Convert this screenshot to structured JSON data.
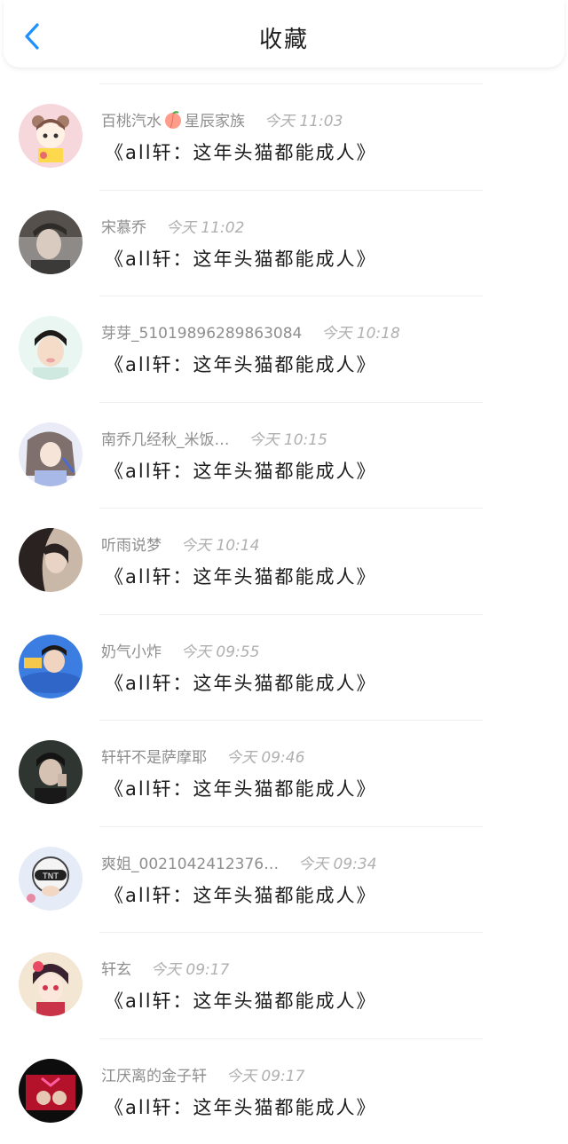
{
  "header": {
    "title": "收藏"
  },
  "items": [
    {
      "name": "百桃汽水",
      "name_suffix": "星辰家族",
      "time": "今天 11:03",
      "message": "《all轩：这年头猫都能成人》"
    },
    {
      "name": "宋慕乔",
      "name_suffix": "",
      "time": "今天 11:02",
      "message": "《all轩：这年头猫都能成人》"
    },
    {
      "name": "芽芽_5101989628986308​4",
      "name_suffix": "",
      "time": "今天 10:18",
      "message": "《all轩：这年头猫都能成人》"
    },
    {
      "name": "南乔几经秋_米饭…",
      "name_suffix": "",
      "time": "今天 10:15",
      "message": "《all轩：这年头猫都能成人》"
    },
    {
      "name": "听雨说梦",
      "name_suffix": "",
      "time": "今天 10:14",
      "message": "《all轩：这年头猫都能成人》"
    },
    {
      "name": "奶气小炸",
      "name_suffix": "",
      "time": "今天 09:55",
      "message": "《all轩：这年头猫都能成人》"
    },
    {
      "name": "轩轩不是萨摩耶",
      "name_suffix": "",
      "time": "今天 09:46",
      "message": "《all轩：这年头猫都能成人》"
    },
    {
      "name": "爽姐_0021042412376…",
      "name_suffix": "",
      "time": "今天 09:34",
      "message": "《all轩：这年头猫都能成人》"
    },
    {
      "name": "轩玄",
      "name_suffix": "",
      "time": "今天 09:17",
      "message": "《all轩：这年头猫都能成人》"
    },
    {
      "name": "江厌离的金子轩",
      "name_suffix": "",
      "time": "今天 09:17",
      "message": "《all轩：这年头猫都能成人》"
    }
  ],
  "colors": {
    "accent": "#1e90ff",
    "name_text": "#8e8e8e",
    "message_text": "#1c1c1c"
  },
  "icons": {
    "back": "chevron-left-icon",
    "emoji": "peach-emoji-icon"
  }
}
